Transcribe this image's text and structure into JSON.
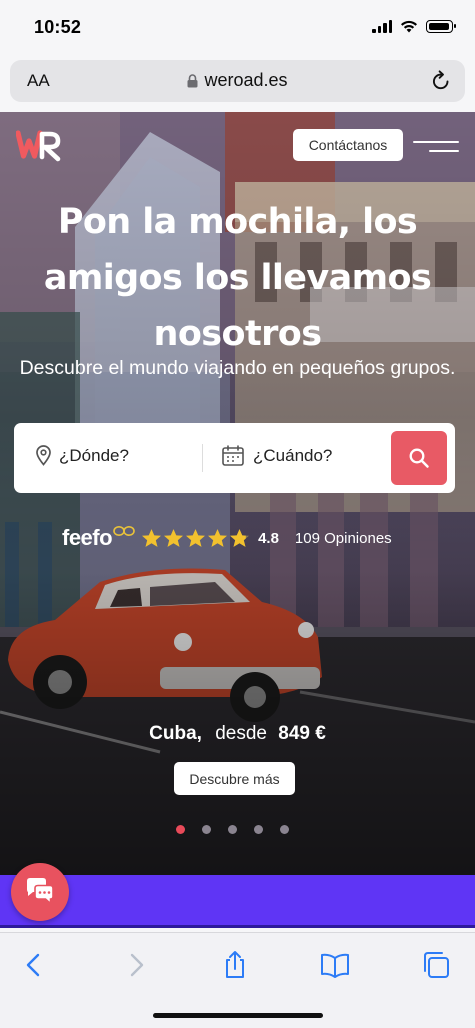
{
  "status_bar": {
    "time": "10:52"
  },
  "url_bar": {
    "text_size_label": "AA",
    "domain": "weroad.es"
  },
  "header": {
    "logo_text": "WR",
    "contact_label": "Contáctanos"
  },
  "hero": {
    "title": "Pon la mochila, los amigos los llevamos nosotros",
    "subtitle": "Descubre el mundo viajando en pequeños grupos."
  },
  "search": {
    "where_label": "¿Dónde?",
    "when_label": "¿Cuándo?"
  },
  "rating": {
    "brand": "feefo",
    "stars": 4.8,
    "score": "4.8",
    "reviews": "109 Opiniones"
  },
  "featured": {
    "city": "Cuba,",
    "from_label": "desde",
    "price": "849 €",
    "cta_label": "Descubre más"
  },
  "carousel": {
    "total": 5,
    "active_index": 0
  },
  "colors": {
    "accent": "#e85a65",
    "purple_band": "#5f35f5",
    "ios_blue": "#2d7cf6"
  },
  "toolbar_icons": [
    "back-icon",
    "forward-icon",
    "share-icon",
    "bookmarks-icon",
    "tabs-icon"
  ]
}
